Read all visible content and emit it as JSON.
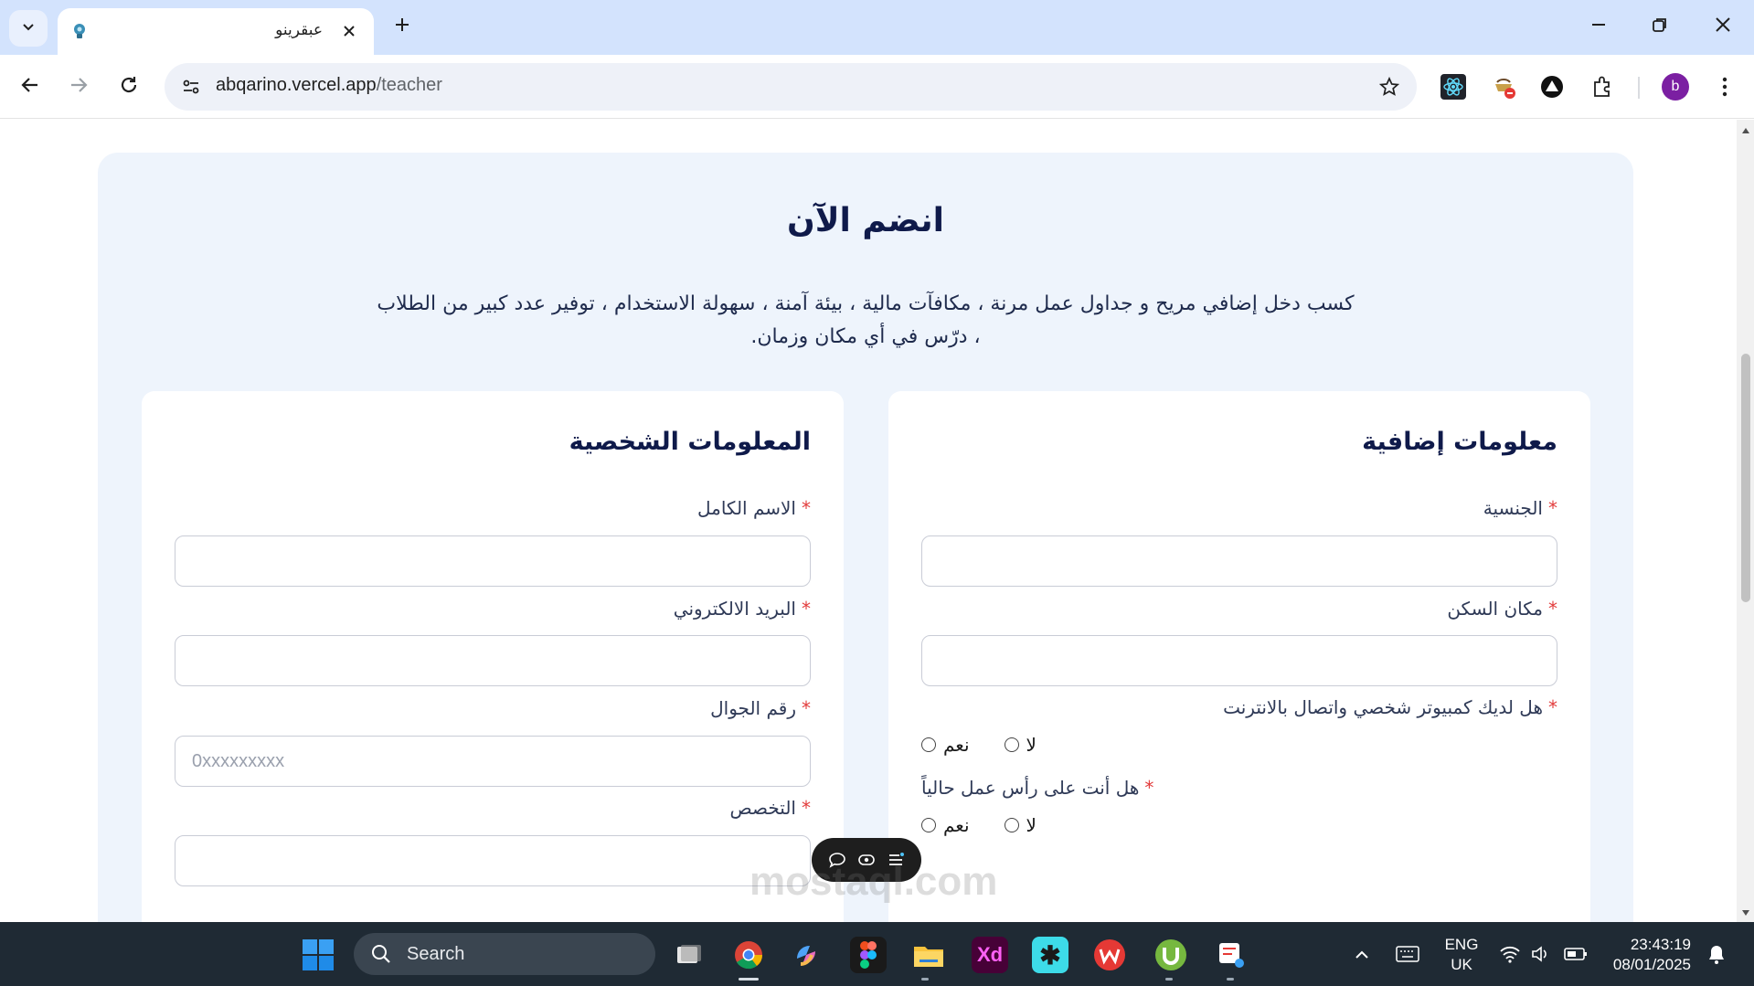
{
  "browser": {
    "tab": {
      "title": "عبقرينو",
      "favicon": "lightbulb-icon"
    },
    "url": {
      "domain": "abqarino.vercel.app",
      "path": "/teacher"
    },
    "extensions": [
      "react-devtools-icon",
      "extension-blocked-icon",
      "triangle-extension-icon",
      "puzzle-extensions-icon"
    ],
    "profile_initial": "b"
  },
  "page": {
    "title": "انضم الآن",
    "description": "كسب دخل إضافي مريح و جداول عمل مرنة ، مكافآت مالية ، بيئة آمنة ، سهولة الاستخدام ، توفير عدد كبير من الطلاب ، درّس في أي مكان وزمان.",
    "required_mark": "*",
    "personal": {
      "title": "المعلومات الشخصية",
      "full_name_label": "الاسم الكامل",
      "email_label": "البريد الالكتروني",
      "phone_label": "رقم الجوال",
      "phone_placeholder": "0xxxxxxxxx",
      "specialty_label": "التخصص"
    },
    "additional": {
      "title": "معلومات إضافية",
      "nationality_label": "الجنسية",
      "residence_label": "مكان السكن",
      "computer_question": "هل لديك كمبيوتر شخصي واتصال بالانترنت",
      "working_question": "هل أنت على رأس عمل حالياً",
      "yes": "نعم",
      "no": "لا"
    }
  },
  "taskbar": {
    "search_label": "Search",
    "language": "ENG",
    "region": "UK",
    "time": "23:43:19",
    "date": "08/01/2025",
    "watermark": "mostaql.com"
  }
}
